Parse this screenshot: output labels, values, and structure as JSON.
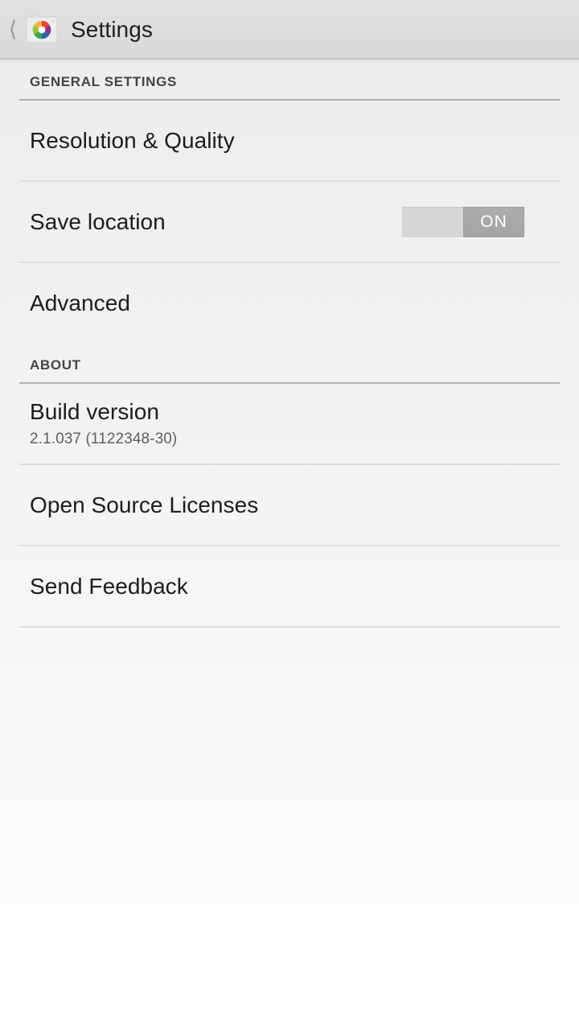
{
  "action_bar": {
    "back_icon": "back-chevron-icon",
    "app_icon": "google-camera-icon",
    "title": "Settings"
  },
  "sections": [
    {
      "header": "GENERAL SETTINGS",
      "rows": [
        {
          "title": "Resolution & Quality",
          "summary": null,
          "control": null,
          "divider_after": true
        },
        {
          "title": "Save location",
          "summary": null,
          "control": "switch",
          "switch_state": "ON",
          "divider_after": true
        },
        {
          "title": "Advanced",
          "summary": null,
          "control": null,
          "divider_after": false
        }
      ]
    },
    {
      "header": "ABOUT",
      "rows": [
        {
          "title": "Build version",
          "summary": "2.1.037 (1122348-30)",
          "control": null,
          "divider_after": true
        },
        {
          "title": "Open Source Licenses",
          "summary": null,
          "control": null,
          "divider_after": true
        },
        {
          "title": "Send Feedback",
          "summary": null,
          "control": null,
          "divider_after": true
        }
      ]
    }
  ],
  "colors": {
    "action_bar_bg": "#dddddd",
    "page_bg_top": "#ededed",
    "page_bg_bottom": "#ffffff",
    "title_text": "#1c1c1c",
    "summary_text": "#5f5f5f",
    "section_header_text": "#454545",
    "section_rule": "#b2b2b2",
    "row_divider": "#dedede",
    "switch_track": "#d6d6d6",
    "switch_thumb": "#a8a8a8",
    "switch_label": "#ffffff"
  }
}
